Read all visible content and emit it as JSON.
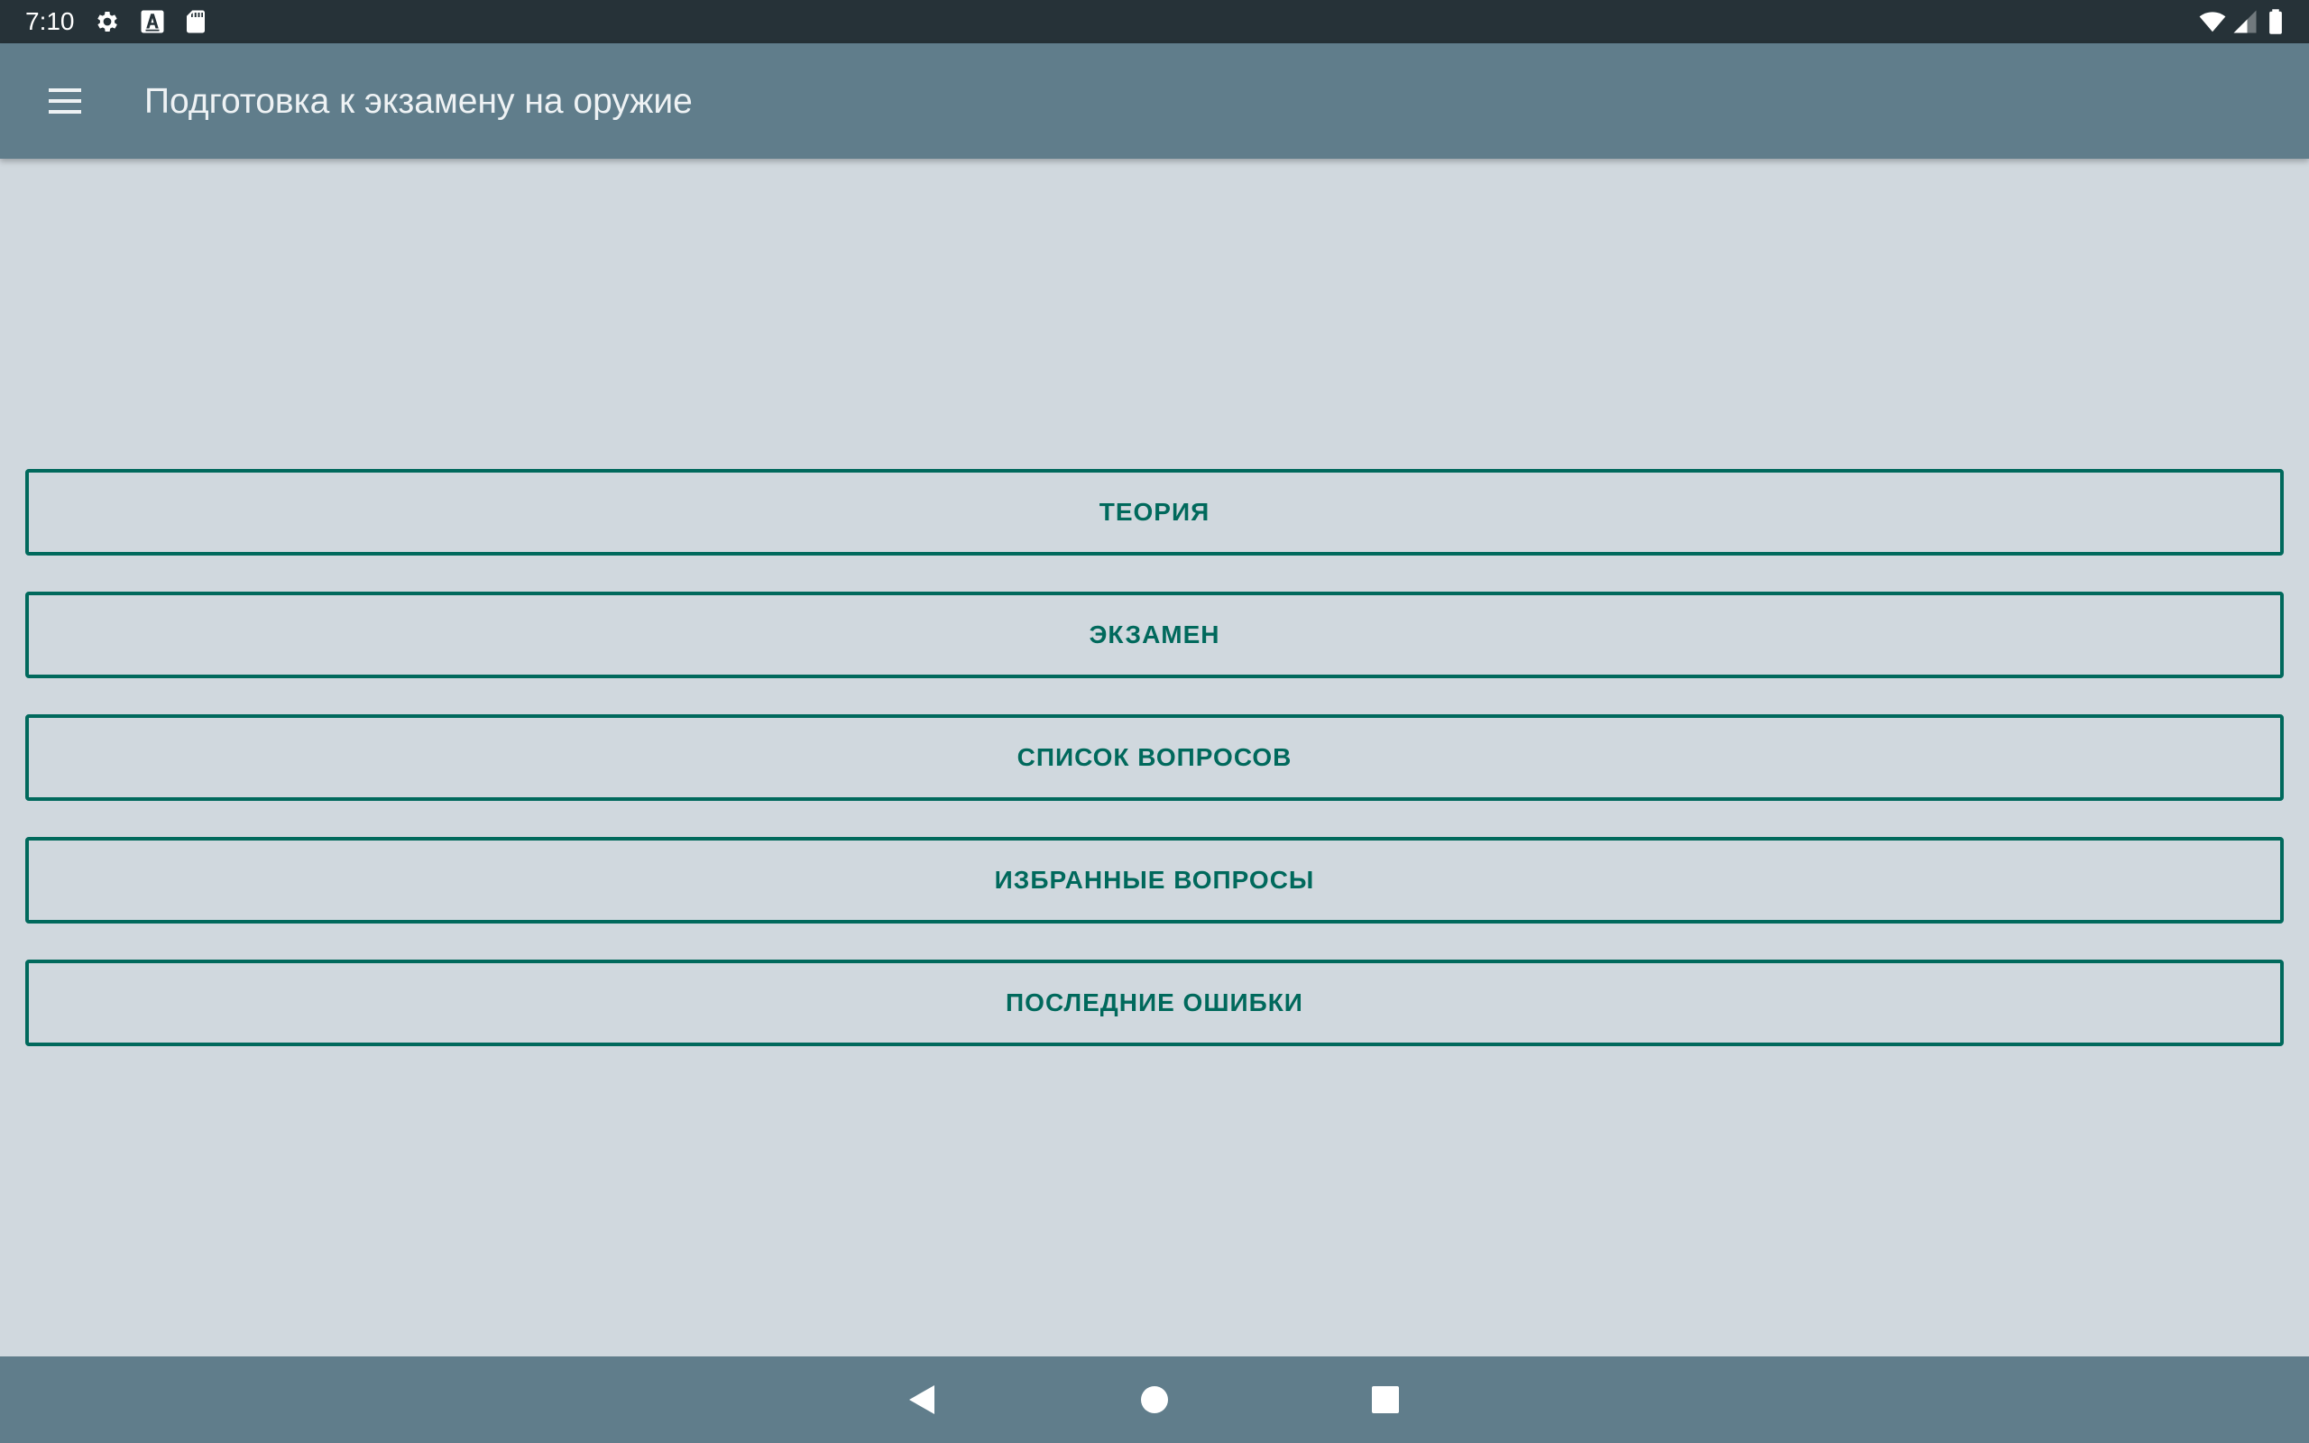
{
  "status_bar": {
    "time": "7:10",
    "left_icons": [
      "settings-icon",
      "keyboard-a-icon",
      "sd-card-icon"
    ],
    "right_icons": [
      "wifi-icon",
      "cell-signal-icon",
      "battery-icon"
    ]
  },
  "app_bar": {
    "menu_icon": "hamburger-menu-icon",
    "title": "Подготовка к экзамену на оружие",
    "background": "#607d8b"
  },
  "menu": {
    "buttons": [
      {
        "label": "ТЕОРИЯ"
      },
      {
        "label": "ЭКЗАМЕН"
      },
      {
        "label": "СПИСОК ВОПРОСОВ"
      },
      {
        "label": "ИЗБРАННЫЕ ВОПРОСЫ"
      },
      {
        "label": "ПОСЛЕДНИЕ ОШИБКИ"
      }
    ],
    "accent_color": "#00695c"
  },
  "nav_bar": {
    "icons": [
      "back-icon",
      "home-icon",
      "recents-icon"
    ]
  },
  "colors": {
    "status_bar": "#263238",
    "background": "#d0d8de",
    "nav_bar": "#607d8b"
  }
}
